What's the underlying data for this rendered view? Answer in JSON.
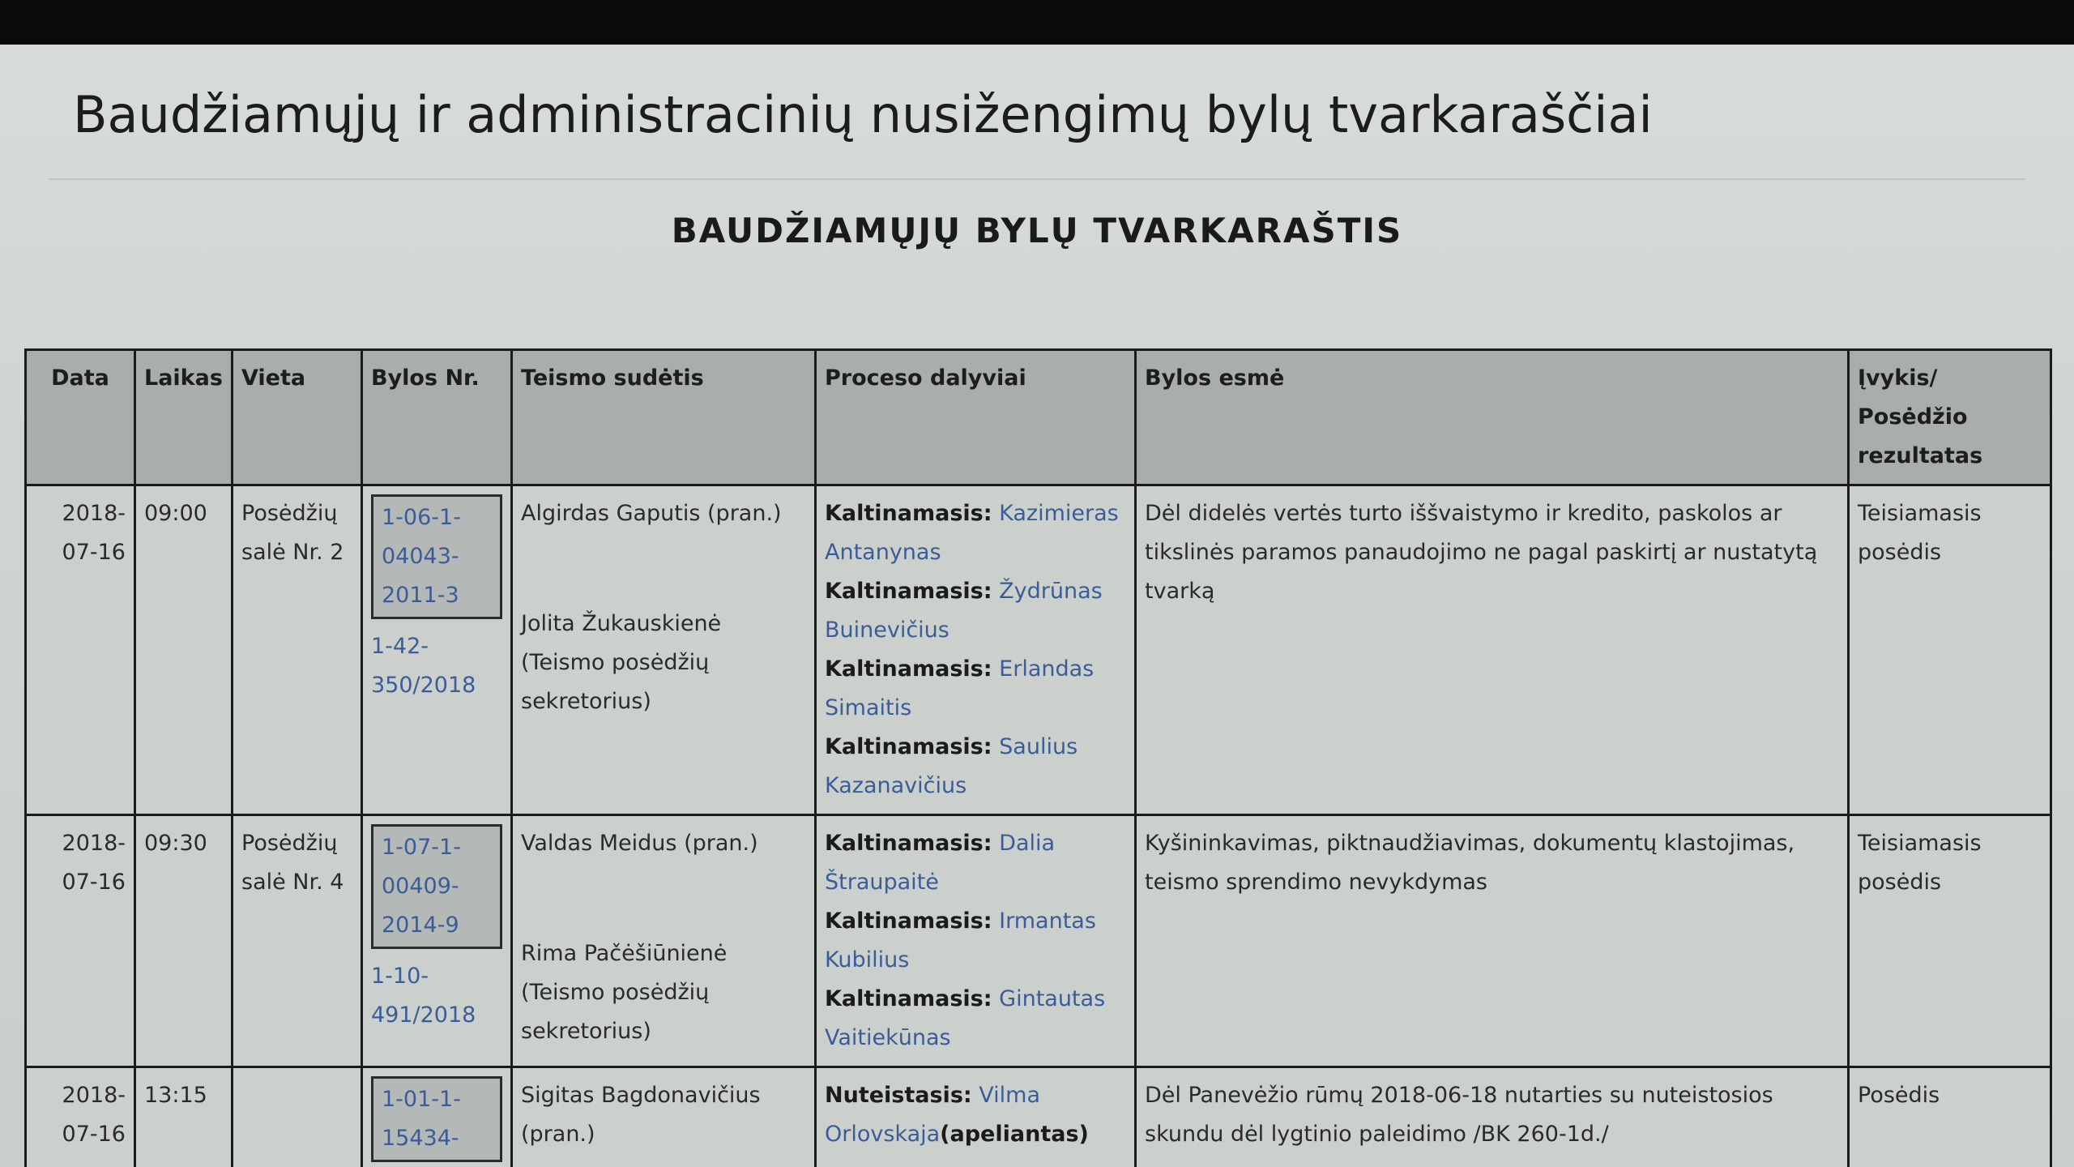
{
  "site_title": "Baudžiamųjų ir administracinių nusižengimų bylų tvarkaraščiai",
  "section_title": "BAUDŽIAMŲJŲ BYLŲ TVARKARAŠTIS",
  "headers": {
    "date": "Data",
    "time": "Laikas",
    "place": "Vieta",
    "case_no": "Bylos Nr.",
    "court": "Teismo sudėtis",
    "participants": "Proceso dalyviai",
    "essence": "Bylos esmė",
    "event_l1": "Įvykis/",
    "event_l2": "Posėdžio",
    "event_l3": "rezultatas"
  },
  "rows": [
    {
      "date": "2018-07-16",
      "time": "09:00",
      "place": "Posėdžių salė Nr. 2",
      "case_boxed": "1-06-1-04043-2011-3",
      "case_plain": "1-42-350/2018",
      "judge": "Algirdas Gaputis (pran.)",
      "secretary": "Jolita Žukauskienė (Teismo posėdžių sekretorius)",
      "parties": [
        {
          "role": "Kaltinamasis:",
          "name": "Kazimieras Antanynas"
        },
        {
          "role": "Kaltinamasis:",
          "name": "Žydrūnas Buinevičius"
        },
        {
          "role": "Kaltinamasis:",
          "name": "Erlandas Simaitis"
        },
        {
          "role": "Kaltinamasis:",
          "name": "Saulius Kazanavičius"
        }
      ],
      "essence": "Dėl didelės vertės turto iššvaistymo ir kredito, paskolos ar tikslinės paramos panaudojimo ne pagal paskirtį ar nustatytą tvarką",
      "event": "Teisiamasis posėdis"
    },
    {
      "date": "2018-07-16",
      "time": "09:30",
      "place": "Posėdžių salė Nr. 4",
      "case_boxed": "1-07-1-00409-2014-9",
      "case_plain": "1-10-491/2018",
      "judge": "Valdas Meidus (pran.)",
      "secretary": "Rima Pačėšiūnienė (Teismo posėdžių sekretorius)",
      "parties": [
        {
          "role": "Kaltinamasis:",
          "name": "Dalia Štraupaitė"
        },
        {
          "role": "Kaltinamasis:",
          "name": "Irmantas Kubilius"
        },
        {
          "role": "Kaltinamasis:",
          "name": "Gintautas Vaitiekūnas"
        }
      ],
      "essence": "Kyšininkavimas, piktnaudžiavimas, dokumentų klastojimas, teismo sprendimo nevykdymas",
      "event": "Teisiamasis posėdis"
    },
    {
      "date": "2018-07-16",
      "time": "13:15",
      "place": "",
      "case_boxed": "1-01-1-15434-",
      "case_plain": "",
      "judge": "Sigitas Bagdonavičius (pran.)",
      "secretary": "",
      "parties": [
        {
          "role": "Nuteistasis:",
          "name": "Vilma Orlovskaja",
          "suffix": "(apeliantas)"
        }
      ],
      "essence": "Dėl Panevėžio rūmų 2018-06-18 nutarties su nuteistosios skundu dėl lygtinio paleidimo /BK 260-1d./",
      "event": "Posėdis"
    }
  ]
}
